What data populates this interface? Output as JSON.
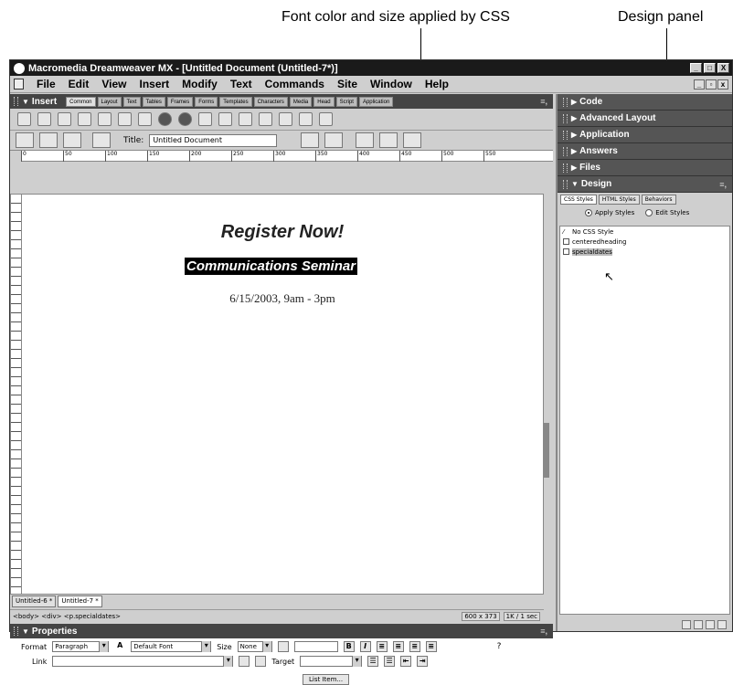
{
  "callouts": {
    "font": "Font color and size applied by CSS",
    "design": "Design panel"
  },
  "window": {
    "title": "Macromedia Dreamweaver MX - [Untitled Document (Untitled-7*)]",
    "controls": [
      "_",
      "□",
      "X"
    ]
  },
  "menu": [
    "File",
    "Edit",
    "View",
    "Insert",
    "Modify",
    "Text",
    "Commands",
    "Site",
    "Window",
    "Help"
  ],
  "insert_panel": {
    "title": "Insert",
    "tabs": [
      "Common",
      "Layout",
      "Text",
      "Tables",
      "Frames",
      "Forms",
      "Templates",
      "Characters",
      "Media",
      "Head",
      "Script",
      "Application"
    ]
  },
  "doc_toolbar": {
    "title_label": "Title:",
    "title_value": "Untitled Document"
  },
  "ruler": [
    "0",
    "50",
    "100",
    "150",
    "200",
    "250",
    "300",
    "350",
    "400",
    "450",
    "500",
    "550"
  ],
  "document": {
    "heading": "Register Now!",
    "seminar": "Communications Seminar",
    "date": "6/15/2003, 9am - 3pm"
  },
  "doc_tabs": [
    "Untitled-6 *",
    "Untitled-7 *"
  ],
  "status": {
    "tags": "<body> <div> <p.specialdates>",
    "size": "600 x 373",
    "weight": "1K / 1 sec"
  },
  "properties": {
    "title": "Properties",
    "format_label": "Format",
    "format_value": "Paragraph",
    "font_value": "Default Font",
    "size_label": "Size",
    "size_value": "None",
    "link_label": "Link",
    "target_label": "Target",
    "list_item_button": "List Item..."
  },
  "right_panels": [
    "Code",
    "Advanced Layout",
    "Application",
    "Answers",
    "Files"
  ],
  "design_panel": {
    "title": "Design",
    "tabs": [
      "CSS Styles",
      "HTML Styles",
      "Behaviors"
    ],
    "apply_styles": "Apply Styles",
    "edit_styles": "Edit Styles",
    "styles": [
      "No CSS Style",
      "centeredheading",
      "specialdates"
    ]
  }
}
